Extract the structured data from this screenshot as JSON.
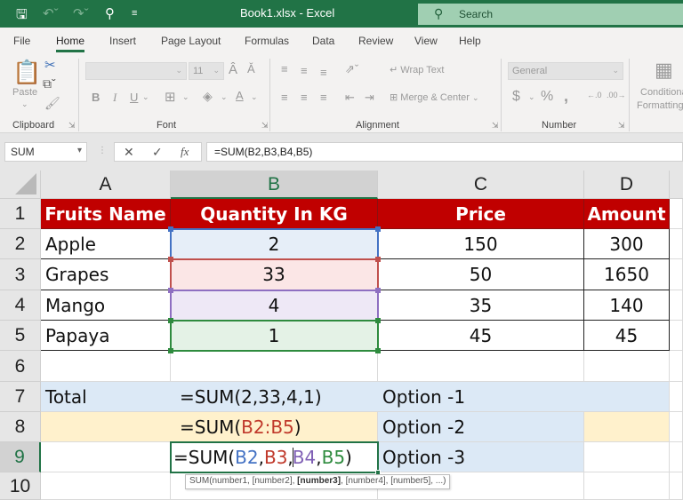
{
  "titlebar": {
    "title": "Book1.xlsx  -  Excel",
    "search_placeholder": "Search",
    "quick_access": {
      "save_icon": "save-icon",
      "undo_icon": "undo-icon",
      "redo_icon": "redo-icon",
      "search_icon": "magnifier-icon",
      "customize_icon": "customize-dropdown-icon"
    }
  },
  "menu": {
    "tabs": [
      "File",
      "Home",
      "Insert",
      "Page Layout",
      "Formulas",
      "Data",
      "Review",
      "View",
      "Help"
    ],
    "active": "Home"
  },
  "ribbon": {
    "clipboard": {
      "label": "Clipboard",
      "paste": "Paste"
    },
    "font": {
      "label": "Font",
      "font_name": "",
      "font_size": "11"
    },
    "alignment": {
      "label": "Alignment",
      "wrap_text": "Wrap Text",
      "merge_center": "Merge & Center"
    },
    "number": {
      "label": "Number",
      "format": "General"
    },
    "styles": {
      "conditional_formatting_line1": "Conditional",
      "conditional_formatting_line2": "Formatting"
    }
  },
  "formula_bar": {
    "name_box": "SUM",
    "formula": "=SUM(B2,B3,B4,B5)"
  },
  "sheet": {
    "columns": [
      "A",
      "B",
      "C",
      "D"
    ],
    "rows": [
      "1",
      "2",
      "3",
      "4",
      "5",
      "6",
      "7",
      "8",
      "9",
      "10"
    ],
    "header": [
      "Fruits Name",
      "Quantity In KG",
      "Price",
      "Amount"
    ],
    "data": [
      {
        "name": "Apple",
        "qty": "2",
        "price": "150",
        "amount": "300"
      },
      {
        "name": "Grapes",
        "qty": "33",
        "price": "50",
        "amount": "1650"
      },
      {
        "name": "Mango",
        "qty": "4",
        "price": "35",
        "amount": "140"
      },
      {
        "name": "Papaya",
        "qty": "1",
        "price": "45",
        "amount": "45"
      }
    ],
    "total_label": "Total",
    "formulas": {
      "row7": "=SUM(2,33,4,1)",
      "row8_prefix": "=SUM(",
      "row8_ref": "B2:B5",
      "row8_suffix": ")",
      "row9_prefix": "=SUM(",
      "row9_refs": [
        "B2",
        "B3",
        "B4",
        "B5"
      ],
      "row9_suffix": ")",
      "comma": ","
    },
    "options": [
      "Option -1",
      "Option -2",
      "Option -3"
    ],
    "tooltip": {
      "prefix": "SUM(number1, [number2], ",
      "bold": "[number3]",
      "suffix": ", [number4], [number5], ...)"
    }
  },
  "colors": {
    "excel_green": "#217346",
    "header_red": "#c00000",
    "ref_blue": "#4472c4",
    "ref_red": "#c0392b",
    "ref_purple": "#7f5fb5",
    "ref_green": "#2e8b3e",
    "option_blue_fill": "#dce9f6",
    "option_yellow_fill": "#fff1cc"
  }
}
